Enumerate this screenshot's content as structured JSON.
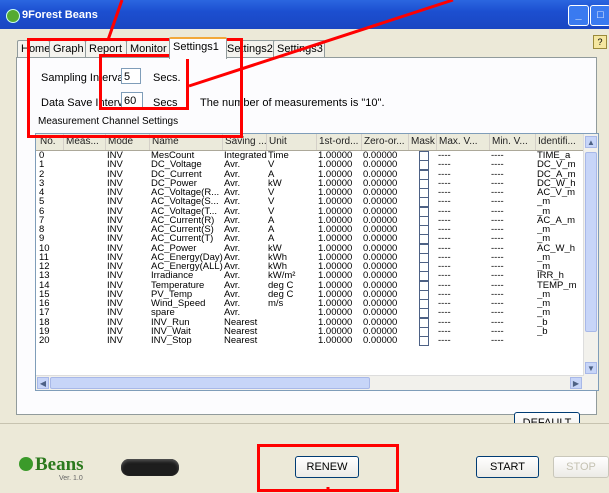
{
  "window": {
    "title": "9Forest Beans",
    "help_glyph": "?"
  },
  "tabs": [
    {
      "label": "Home"
    },
    {
      "label": "Graph"
    },
    {
      "label": "Report"
    },
    {
      "label": "Monitor"
    },
    {
      "label": "Settings1"
    },
    {
      "label": "Settings2"
    },
    {
      "label": "Settings3"
    }
  ],
  "active_tab": "Settings1",
  "settings": {
    "sampling_label": "Sampling Interval",
    "sampling_value": "5",
    "sampling_unit": "Secs.",
    "save_label": "Data Save Interval",
    "save_value": "60",
    "save_unit": "Secs",
    "measurement_note": "The number of measurements is \"10\".",
    "group_title": "Measurement Channel Settings"
  },
  "table": {
    "columns": [
      "No.",
      "Meas...",
      "Mode",
      "Name",
      "Saving ...",
      "Unit",
      "1st-ord...",
      "Zero-or...",
      "Mask",
      "Max. V...",
      "Min. V...",
      "Identifi..."
    ],
    "rows": [
      [
        "0",
        "",
        "INV",
        "MesCount",
        "Integrated",
        "Time",
        "1.00000",
        "0.00000",
        "----",
        "----",
        "TIME_a"
      ],
      [
        "1",
        "",
        "INV",
        "DC_Voltage",
        "Avr.",
        "V",
        "1.00000",
        "0.00000",
        "----",
        "----",
        "DC_V_m"
      ],
      [
        "2",
        "",
        "INV",
        "DC_Current",
        "Avr.",
        "A",
        "1.00000",
        "0.00000",
        "----",
        "----",
        "DC_A_m"
      ],
      [
        "3",
        "",
        "INV",
        "DC_Power",
        "Avr.",
        "kW",
        "1.00000",
        "0.00000",
        "----",
        "----",
        "DC_W_h"
      ],
      [
        "4",
        "",
        "INV",
        "AC_Voltage(R...",
        "Avr.",
        "V",
        "1.00000",
        "0.00000",
        "----",
        "----",
        "AC_V_m"
      ],
      [
        "5",
        "",
        "INV",
        "AC_Voltage(S...",
        "Avr.",
        "V",
        "1.00000",
        "0.00000",
        "----",
        "----",
        "_m"
      ],
      [
        "6",
        "",
        "INV",
        "AC_Voltage(T...",
        "Avr.",
        "V",
        "1.00000",
        "0.00000",
        "----",
        "----",
        "_m"
      ],
      [
        "7",
        "",
        "INV",
        "AC_Current(R)",
        "Avr.",
        "A",
        "1.00000",
        "0.00000",
        "----",
        "----",
        "AC_A_m"
      ],
      [
        "8",
        "",
        "INV",
        "AC_Current(S)",
        "Avr.",
        "A",
        "1.00000",
        "0.00000",
        "----",
        "----",
        "_m"
      ],
      [
        "9",
        "",
        "INV",
        "AC_Current(T)",
        "Avr.",
        "A",
        "1.00000",
        "0.00000",
        "----",
        "----",
        "_m"
      ],
      [
        "10",
        "",
        "INV",
        "AC_Power",
        "Avr.",
        "kW",
        "1.00000",
        "0.00000",
        "----",
        "----",
        "AC_W_h"
      ],
      [
        "11",
        "",
        "INV",
        "AC_Energy(Day)",
        "Avr.",
        "kWh",
        "1.00000",
        "0.00000",
        "----",
        "----",
        "_m"
      ],
      [
        "12",
        "",
        "INV",
        "AC_Energy(ALL)",
        "Avr.",
        "kWh",
        "1.00000",
        "0.00000",
        "----",
        "----",
        "_m"
      ],
      [
        "13",
        "",
        "INV",
        "Irradiance",
        "Avr.",
        "kW/m²",
        "1.00000",
        "0.00000",
        "----",
        "----",
        "IRR_h"
      ],
      [
        "14",
        "",
        "INV",
        "Temperature",
        "Avr.",
        "deg C",
        "1.00000",
        "0.00000",
        "----",
        "----",
        "TEMP_m"
      ],
      [
        "15",
        "",
        "INV",
        "PV_Temp",
        "Avr.",
        "deg C",
        "1.00000",
        "0.00000",
        "----",
        "----",
        "_m"
      ],
      [
        "16",
        "",
        "INV",
        "Wind_Speed",
        "Avr.",
        "m/s",
        "1.00000",
        "0.00000",
        "----",
        "----",
        "_m"
      ],
      [
        "17",
        "",
        "INV",
        "spare",
        "Avr.",
        "",
        "1.00000",
        "0.00000",
        "----",
        "----",
        "_m"
      ],
      [
        "18",
        "",
        "INV",
        "INV_Run",
        "Nearest",
        "",
        "1.00000",
        "0.00000",
        "----",
        "----",
        "_b"
      ],
      [
        "19",
        "",
        "INV",
        "INV_Wait",
        "Nearest",
        "",
        "1.00000",
        "0.00000",
        "----",
        "----",
        "_b"
      ],
      [
        "20",
        "",
        "INV",
        "INV_Stop",
        "Nearest",
        "",
        "1.00000",
        "0.00000",
        "----",
        "----",
        ""
      ]
    ]
  },
  "buttons": {
    "default": "DEFAULT",
    "renew": "RENEW",
    "start": "START",
    "stop": "STOP"
  },
  "logo": {
    "word": "Beans",
    "version": "Ver. 1.0"
  },
  "colors": {
    "annotation": "#ff0000",
    "title_bar": "#1c4fd0",
    "logo_green": "#3b9a2a"
  }
}
